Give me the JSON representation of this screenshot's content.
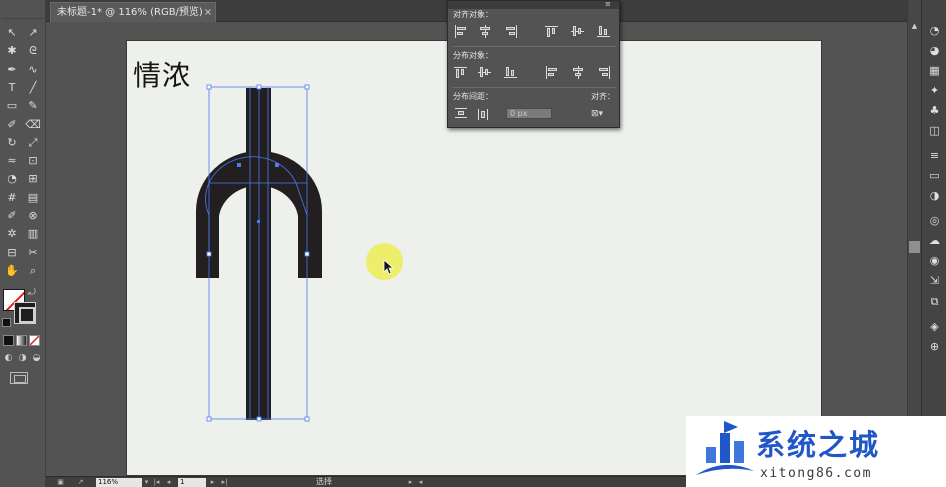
{
  "document_tab": {
    "title": "未标题-1* @ 116% (RGB/预览)",
    "close": "×"
  },
  "artboard": {
    "text": "情浓"
  },
  "align_panel": {
    "menu_icon": "panel-menu-icon",
    "align_objects_label": "对齐对象：",
    "distribute_objects_label": "分布对象：",
    "distribute_spacing_label": "分布间距：",
    "align_to_label": "对齐：",
    "spacing_value": "0 px",
    "align_to_value": "⊠▾"
  },
  "status_bar": {
    "zoom": "116%",
    "page": "1",
    "tool_label": "选择"
  },
  "watermark": {
    "title": "系统之城",
    "url": "xitong86.com"
  },
  "colors": {
    "ui_bg": "#535353",
    "artboard": "#eef0ec",
    "glyph_fill": "#231f20",
    "selection": "#4a7cf0",
    "cursor_halo": "#eded5f",
    "watermark_blue": "#1f56c8"
  },
  "tools": [
    "selection-tool-icon",
    "direct-selection-tool-icon",
    "magic-wand-icon",
    "lasso-icon",
    "pen-tool-icon",
    "curvature-icon",
    "type-tool-icon",
    "line-tool-icon",
    "rectangle-tool-icon",
    "paintbrush-icon",
    "pencil-icon",
    "eraser-icon",
    "rotate-tool-icon",
    "scale-tool-icon",
    "width-tool-icon",
    "free-transform-icon",
    "shape-builder-icon",
    "perspective-grid-icon",
    "mesh-tool-icon",
    "gradient-tool-icon",
    "eyedropper-icon",
    "blend-tool-icon",
    "symbol-sprayer-icon",
    "graph-tool-icon",
    "artboard-tool-icon",
    "slice-tool-icon",
    "hand-tool-icon",
    "zoom-tool-icon"
  ],
  "panel_icons": [
    "color-panel-icon",
    "color-guide-icon",
    "swatches-icon",
    "brushes-icon",
    "symbols-icon",
    "graphic-styles-icon",
    "stroke-icon",
    "gradient-panel-icon",
    "transparency-icon",
    "appearance-icon",
    "cc-libraries-icon",
    "image-trace-icon",
    "asset-export-icon",
    "artboards-icon",
    "layers-icon",
    "links-icon"
  ]
}
